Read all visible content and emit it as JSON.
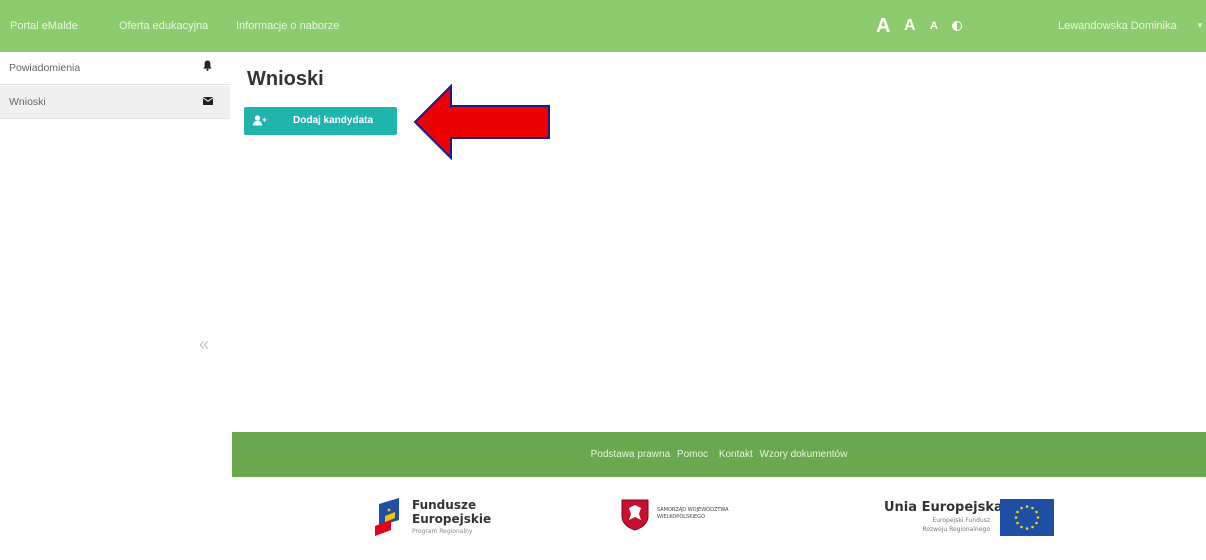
{
  "topnav": {
    "items": [
      "Portal eMalde",
      "Oferta edukacyjna",
      "Informacje o naborze"
    ],
    "font_sizes": [
      "A",
      "A",
      "A"
    ],
    "user": "Lewandowska Dominika"
  },
  "sidebar": {
    "items": [
      {
        "label": "Powiadomienia",
        "icon": "bell-icon"
      },
      {
        "label": "Wnioski",
        "icon": "envelope-icon"
      }
    ],
    "collapse": "«"
  },
  "main": {
    "title": "Wnioski",
    "add_button": "Dodaj kandydata"
  },
  "footer": {
    "links": [
      "Podstawa prawna",
      "Pomoc",
      "Kontakt",
      "Wzory dokumentów"
    ]
  },
  "logos": {
    "fe": {
      "line1": "Fundusze",
      "line2": "Europejskie",
      "line3": "Program Regionalny"
    },
    "samorzad": {
      "line1": "SAMORZĄD WOJEWÓDZTWA",
      "line2": "WIELKOPOLSKIEGO"
    },
    "ue": {
      "line1": "Unia Europejska",
      "line2": "Europejski Fundusz",
      "line3": "Rozwoju Regionalnego"
    }
  },
  "colors": {
    "topbar": "#8dcb6f",
    "footer": "#6aa84f",
    "button": "#1fb5ad",
    "arrow": "#ee0000",
    "eu_flag": "#1d4fa5"
  }
}
